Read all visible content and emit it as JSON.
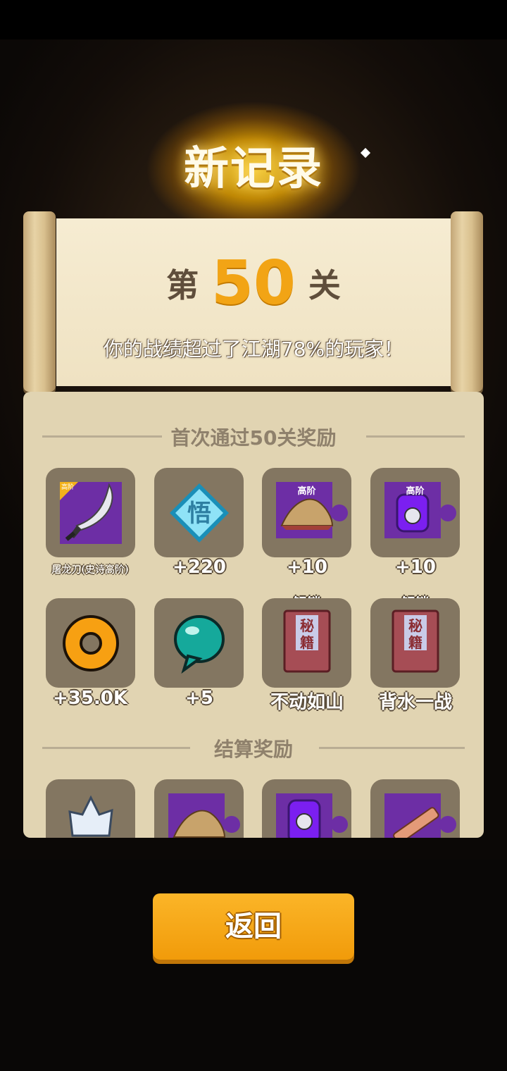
{
  "header": {
    "title": "新记录"
  },
  "scroll": {
    "level_prefix": "第",
    "level_number": "50",
    "level_suffix": "关",
    "percent_text": "你的战绩超过了江湖78%的玩家！"
  },
  "first_clear": {
    "title": "首次通过50关奖励",
    "items": [
      {
        "icon": "dragon-blade-icon",
        "label": "屠龙刀(史诗高阶)",
        "corner_badge": "高阶"
      },
      {
        "icon": "wu-diamond-icon",
        "glyph": "悟",
        "label": "+220"
      },
      {
        "icon": "straw-hat-icon",
        "tag": "高阶",
        "label": "+10"
      },
      {
        "icon": "purple-armor-icon",
        "tag": "高阶",
        "label": "+10"
      },
      {
        "icon": "gold-coin-icon",
        "label": "+35.0K"
      },
      {
        "icon": "teal-gem-icon",
        "label": "+5"
      },
      {
        "icon": "secret-book-icon",
        "top": "解锁",
        "book_text": "秘籍",
        "label": "不动如山"
      },
      {
        "icon": "secret-book-icon",
        "top": "解锁",
        "book_text": "秘籍",
        "label": "背水一战"
      }
    ]
  },
  "settlement": {
    "title": "结算奖励",
    "items": [
      {
        "icon": "crystal-icon"
      },
      {
        "icon": "straw-hat-icon"
      },
      {
        "icon": "purple-armor-icon"
      },
      {
        "icon": "wooden-staff-icon"
      }
    ]
  },
  "buttons": {
    "return_label": "返回"
  },
  "colors": {
    "accent": "#f2a415",
    "panel": "#e1d4b2",
    "slot": "#837661",
    "rare_purple": "#6d2ea5"
  }
}
